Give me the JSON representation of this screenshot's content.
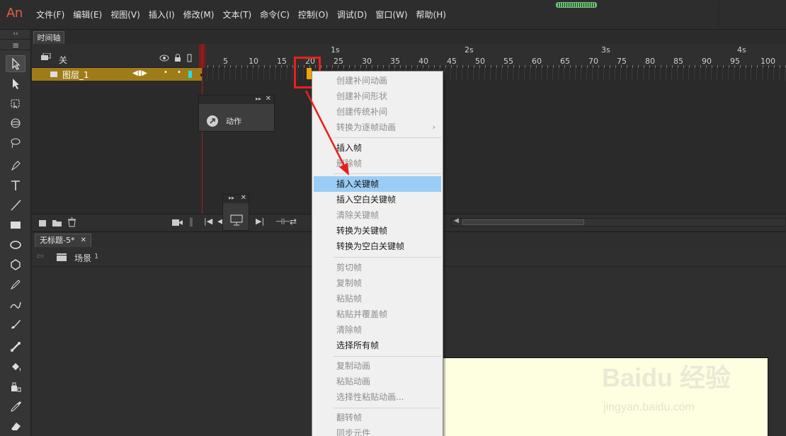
{
  "app": {
    "logo": "An"
  },
  "menu": [
    "文件(F)",
    "编辑(E)",
    "视图(V)",
    "插入(I)",
    "修改(M)",
    "文本(T)",
    "命令(C)",
    "控制(O)",
    "调试(D)",
    "窗口(W)",
    "帮助(H)"
  ],
  "timeline": {
    "tab_label": "时间轴",
    "header_layer_label": "关",
    "layer_name": "图层_1",
    "ruler_frames": [
      "1",
      "5",
      "10",
      "15",
      "20",
      "25",
      "30",
      "35",
      "40",
      "45",
      "50",
      "55",
      "60",
      "65",
      "70",
      "75",
      "80",
      "85",
      "90",
      "95",
      "100"
    ],
    "seconds": [
      "1s",
      "2s",
      "3s",
      "4s"
    ],
    "current_frame": 1,
    "selected_frame": 20
  },
  "actions_panel": {
    "label": "动作"
  },
  "document": {
    "tab_label": "无标题-5*",
    "scene_label": "场景",
    "scene_number": "1"
  },
  "context_menu": {
    "items": [
      {
        "label": "创建补间动画",
        "enabled": false
      },
      {
        "label": "创建补间形状",
        "enabled": false
      },
      {
        "label": "创建传统补间",
        "enabled": false
      },
      {
        "label": "转换为逐帧动画",
        "enabled": false,
        "submenu": true
      },
      {
        "label": "插入帧",
        "enabled": true
      },
      {
        "label": "删除帧",
        "enabled": false
      },
      {
        "label": "插入关键帧",
        "enabled": true,
        "highlighted": true
      },
      {
        "label": "插入空白关键帧",
        "enabled": true
      },
      {
        "label": "清除关键帧",
        "enabled": false
      },
      {
        "label": "转换为关键帧",
        "enabled": true
      },
      {
        "label": "转换为空白关键帧",
        "enabled": true
      },
      {
        "label": "剪切帧",
        "enabled": false
      },
      {
        "label": "复制帧",
        "enabled": false
      },
      {
        "label": "粘贴帧",
        "enabled": false
      },
      {
        "label": "粘贴并覆盖帧",
        "enabled": false
      },
      {
        "label": "清除帧",
        "enabled": false
      },
      {
        "label": "选择所有帧",
        "enabled": true
      },
      {
        "label": "复制动画",
        "enabled": false
      },
      {
        "label": "粘贴动画",
        "enabled": false
      },
      {
        "label": "选择性粘贴动画...",
        "enabled": false
      },
      {
        "label": "翻转帧",
        "enabled": false
      },
      {
        "label": "同步元件",
        "enabled": false
      }
    ]
  },
  "watermark": {
    "brand": "Baidu 经验",
    "url": "jingyan.baidu.com"
  },
  "colors": {
    "accent": "#e0603e",
    "layer_row": "#a07c18",
    "menu_highlight": "#99cdf5",
    "annotation_red": "#e8201c",
    "stage": "#fefee0"
  }
}
